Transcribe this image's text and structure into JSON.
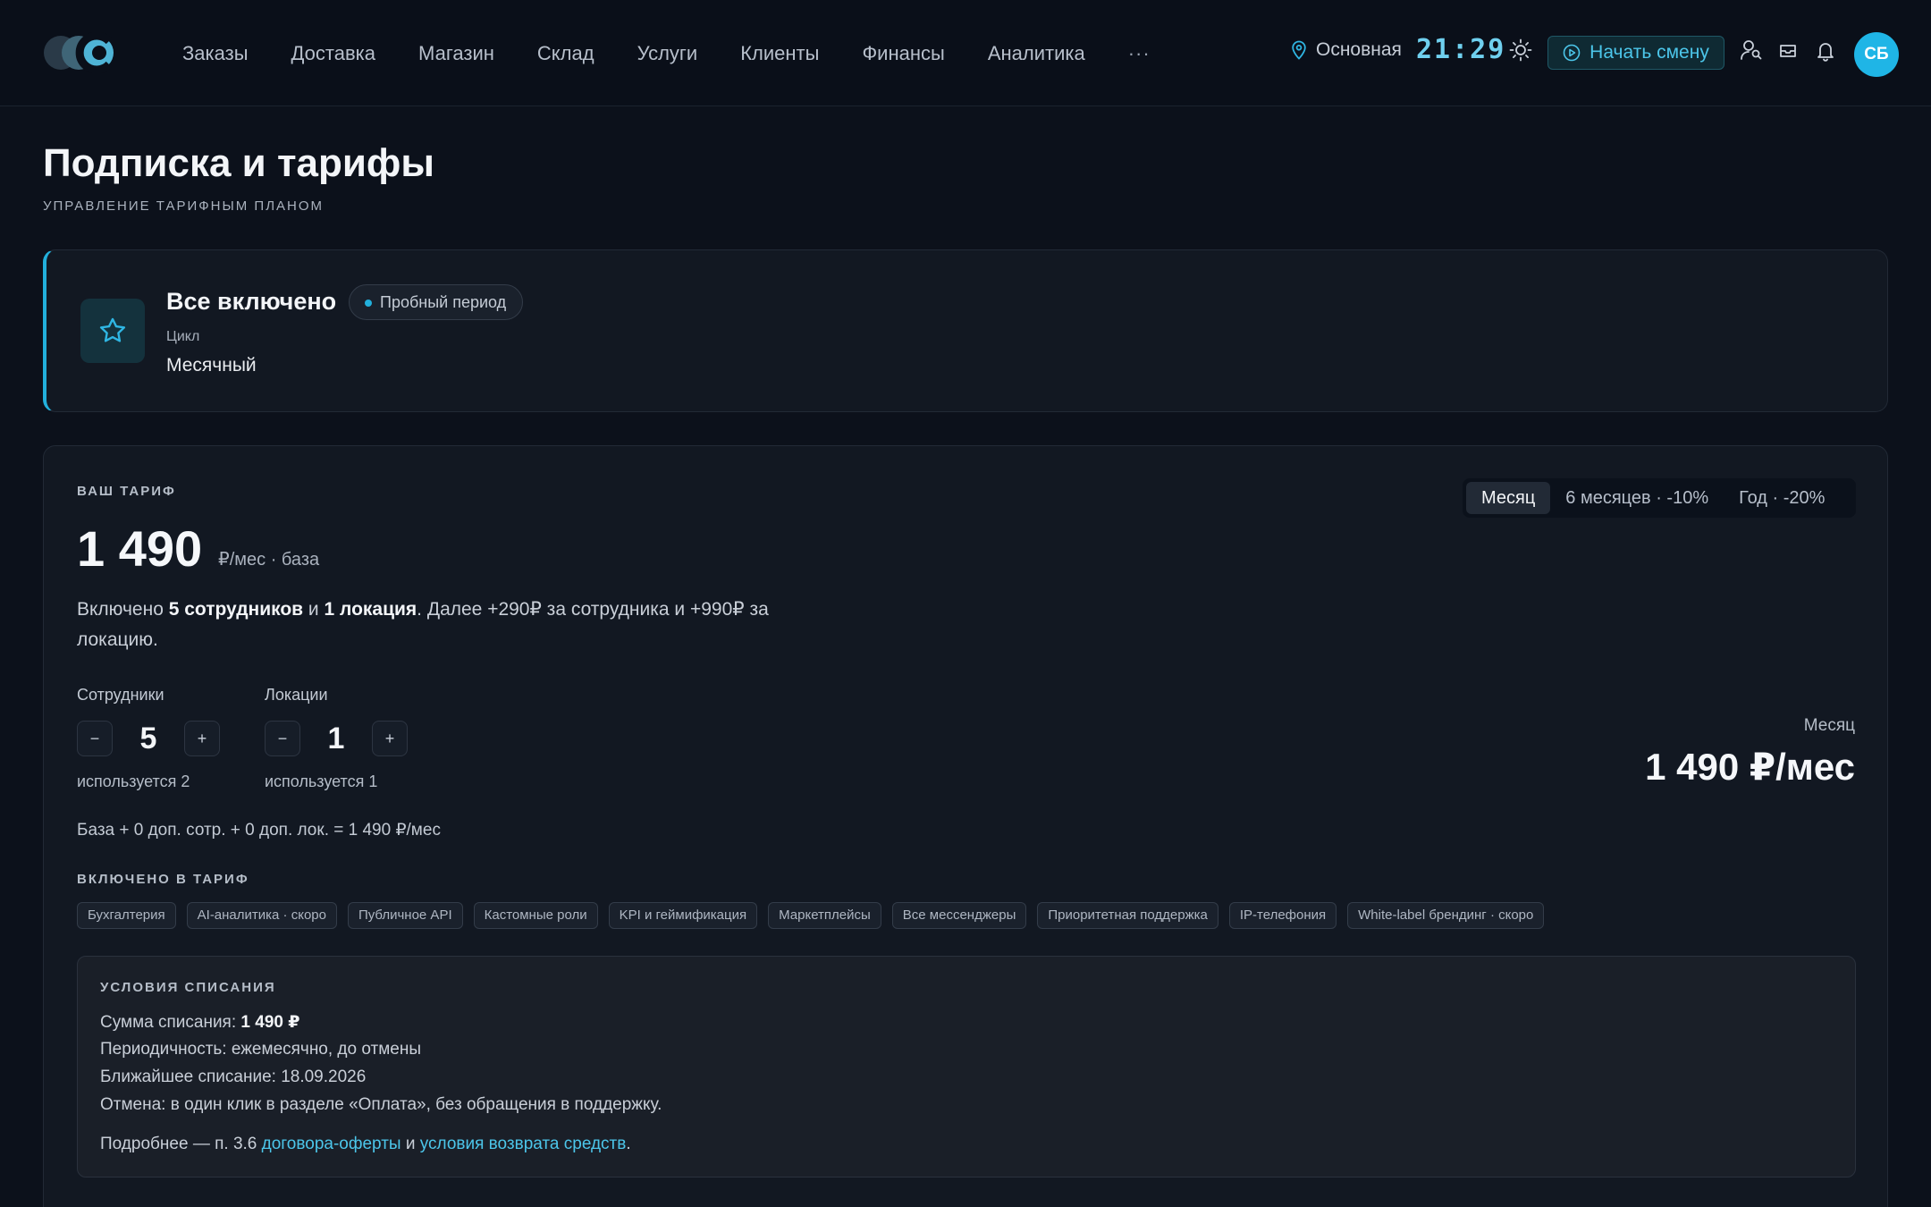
{
  "nav": {
    "items": [
      "Заказы",
      "Доставка",
      "Магазин",
      "Склад",
      "Услуги",
      "Клиенты",
      "Финансы",
      "Аналитика"
    ],
    "more": "···"
  },
  "header": {
    "location": "Основная",
    "clock": "21:29",
    "start_shift": "Начать смену",
    "avatar": "СБ"
  },
  "page": {
    "title": "Подписка и тарифы",
    "subtitle": "УПРАВЛЕНИЕ ТАРИФНЫМ ПЛАНОМ"
  },
  "plan": {
    "name": "Все включено",
    "badge": "Пробный период",
    "cycle_label": "Цикл",
    "cycle_value": "Месячный"
  },
  "tariff": {
    "label": "ВАШ ТАРИФ",
    "price": "1 490",
    "price_unit": "₽/мес · база",
    "included": {
      "prefix": "Включено ",
      "employees": "5 сотрудников",
      "and": " и ",
      "locations": "1 локация",
      "suffix": ". Далее +290₽ за сотрудника и +990₽ за локацию."
    },
    "periods": [
      "Месяц",
      "6 месяцев · -10%",
      "Год · -20%"
    ],
    "active_period": 0,
    "employees": {
      "label": "Сотрудники",
      "value": "5",
      "used": "используется 2",
      "minus": "−",
      "plus": "+"
    },
    "locations": {
      "label": "Локации",
      "value": "1",
      "used": "используется 1",
      "minus": "−",
      "plus": "+"
    },
    "formula": "База + 0 доп. сотр. + 0 доп. лок. = 1 490 ₽/мес",
    "total_label": "Месяц",
    "total_value": "1 490 ₽/мес",
    "features_label": "ВКЛЮЧЕНО В ТАРИФ",
    "features": [
      "Бухгалтерия",
      "AI-аналитика · скоро",
      "Публичное API",
      "Кастомные роли",
      "KPI и геймификация",
      "Маркетплейсы",
      "Все мессенджеры",
      "Приоритетная поддержка",
      "IP-телефония",
      "White-label брендинг · скоро"
    ]
  },
  "terms": {
    "title": "УСЛОВИЯ СПИСАНИЯ",
    "amount_label": "Сумма списания: ",
    "amount_value": "1 490 ₽",
    "periodicity": "Периодичность: ежемесячно, до отмены",
    "next_charge": "Ближайшее списание: 18.09.2026",
    "cancel": "Отмена: в один клик в разделе «Оплата», без обращения в поддержку.",
    "more_prefix": "Подробнее — п. 3.6 ",
    "offer_link": "договора-оферты",
    "and": " и ",
    "refund_link": "условия возврата средств",
    "dot": "."
  },
  "colors": {
    "accent": "#22b0dc",
    "background": "#0c111b",
    "card": "#121822"
  }
}
